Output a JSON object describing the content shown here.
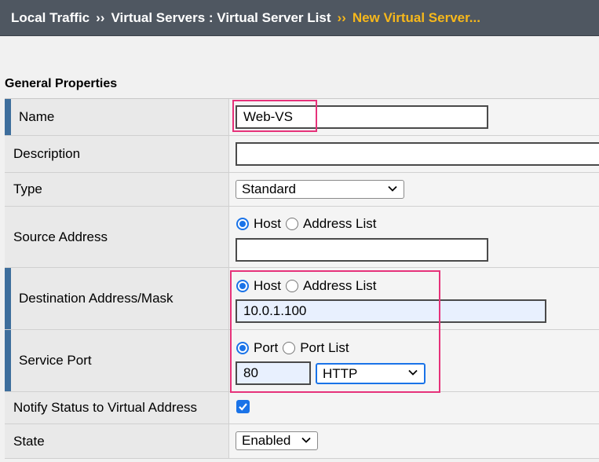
{
  "breadcrumb": {
    "items": [
      "Local Traffic",
      "Virtual Servers : Virtual Server List"
    ],
    "separator": "››",
    "current": "New Virtual Server..."
  },
  "section_title": "General Properties",
  "fields": {
    "name": {
      "label": "Name",
      "value": "Web-VS"
    },
    "description": {
      "label": "Description",
      "value": ""
    },
    "type": {
      "label": "Type",
      "value": "Standard"
    },
    "source_address": {
      "label": "Source Address",
      "radio_host": "Host",
      "radio_list": "Address List",
      "selected": "Host",
      "value": ""
    },
    "destination": {
      "label": "Destination Address/Mask",
      "radio_host": "Host",
      "radio_list": "Address List",
      "selected": "Host",
      "value": "10.0.1.100"
    },
    "service_port": {
      "label": "Service Port",
      "radio_port": "Port",
      "radio_list": "Port List",
      "selected": "Port",
      "value": "80",
      "protocol": "HTTP"
    },
    "notify": {
      "label": "Notify Status to Virtual Address",
      "checked": true
    },
    "state": {
      "label": "State",
      "value": "Enabled"
    }
  },
  "colors": {
    "header_bg": "#4f5761",
    "breadcrumb_current": "#f7b81b",
    "required_marker": "#3e6e9c",
    "highlight": "#e6327a",
    "accent": "#1a73e8"
  }
}
